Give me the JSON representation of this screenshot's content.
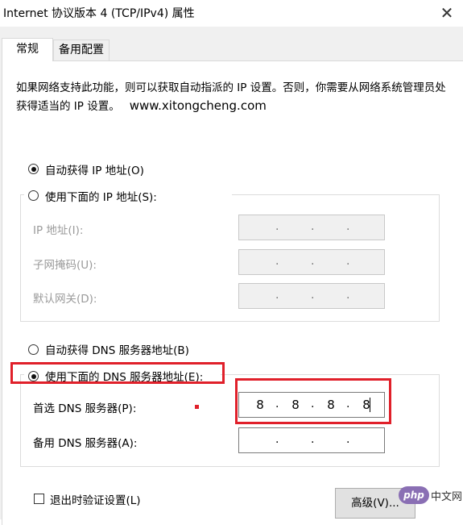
{
  "window": {
    "title": "Internet 协议版本 4 (TCP/IPv4) 属性",
    "close_icon": "close-icon"
  },
  "tabs": [
    {
      "label": "常规",
      "active": true
    },
    {
      "label": "备用配置",
      "active": false
    }
  ],
  "description": {
    "text": "如果网络支持此功能，则可以获取自动指派的 IP 设置。否则，你需要从网络系统管理员处获得适当的 IP 设置。",
    "watermark_url": "www.xitongcheng.com"
  },
  "ip_section": {
    "auto_label": "自动获得 IP 地址(O)",
    "auto_selected": true,
    "manual_label": "使用下面的 IP 地址(S):",
    "manual_selected": false,
    "fields": [
      {
        "label": "IP 地址(I):",
        "value": ""
      },
      {
        "label": "子网掩码(U):",
        "value": ""
      },
      {
        "label": "默认网关(D):",
        "value": ""
      }
    ]
  },
  "dns_section": {
    "auto_label": "自动获得 DNS 服务器地址(B)",
    "auto_selected": false,
    "manual_label": "使用下面的 DNS 服务器地址(E):",
    "manual_selected": true,
    "preferred": {
      "label": "首选 DNS 服务器(P):",
      "octets": [
        "8",
        "8",
        "8",
        "8"
      ]
    },
    "alternate": {
      "label": "备用 DNS 服务器(A):",
      "octets": [
        "",
        "",
        "",
        ""
      ]
    }
  },
  "footer": {
    "validate_label": "退出时验证设置(L)",
    "validate_checked": false,
    "advanced_button": "高级(V)..."
  },
  "badge": {
    "logo": "php",
    "text": "中文网"
  },
  "colors": {
    "highlight": "#e0202a",
    "dialog_bg": "#f0f0f0",
    "disabled_text": "#9a9a9a"
  }
}
